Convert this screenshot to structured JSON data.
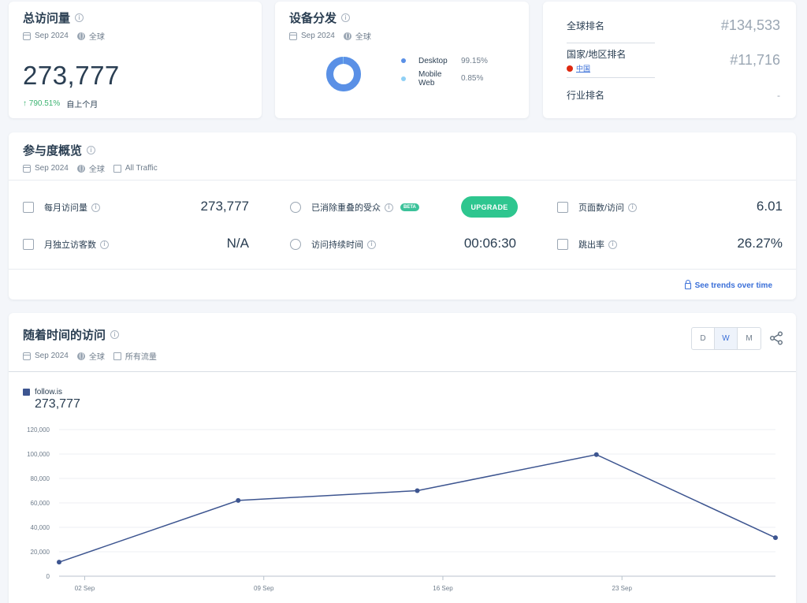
{
  "visits_card": {
    "title": "总访问量",
    "date": "Sep 2024",
    "region": "全球",
    "total": "273,777",
    "change": "↑ 790.51%",
    "change_label": "自上个月"
  },
  "device_card": {
    "title": "设备分发",
    "date": "Sep 2024",
    "region": "全球",
    "items": [
      {
        "name": "Desktop",
        "value": "99.15%",
        "share": 99.15,
        "color": "#5a90e6"
      },
      {
        "name": "Mobile Web",
        "value": "0.85%",
        "share": 0.85,
        "color": "#8fd0f5"
      }
    ]
  },
  "rank_card": {
    "global_label": "全球排名",
    "global_value": "#134,533",
    "country_label": "国家/地区排名",
    "country_name": "中国",
    "country_value": "#11,716",
    "industry_label": "行业排名",
    "industry_value": "-"
  },
  "engagement": {
    "title": "参与度概览",
    "date": "Sep 2024",
    "region": "全球",
    "traffic": "All Traffic",
    "monthly_label": "每月访问量",
    "monthly_value": "273,777",
    "unique_label": "月独立访客数",
    "unique_value": "N/A",
    "dedup_label": "已消除重叠的受众",
    "beta": "BETA",
    "upgrade": "UPGRADE",
    "duration_label": "访问持续时间",
    "duration_value": "00:06:30",
    "pages_label": "页面数/访问",
    "pages_value": "6.01",
    "bounce_label": "跳出率",
    "bounce_value": "26.27%",
    "trends_link": "See trends over time"
  },
  "time_card": {
    "title": "随着时间的访问",
    "date": "Sep 2024",
    "region": "全球",
    "traffic": "所有流量",
    "granularity": [
      "D",
      "W",
      "M"
    ],
    "selected": "W",
    "series_name": "follow.is",
    "series_total": "273,777"
  },
  "chart_data": {
    "type": "line",
    "x": [
      "2024-09-01",
      "2024-09-08",
      "2024-09-15",
      "2024-09-22",
      "2024-09-29"
    ],
    "x_tick_labels": [
      "02 Sep",
      "09 Sep",
      "16 Sep",
      "23 Sep"
    ],
    "y_tick_labels": [
      "120,000",
      "100,000",
      "80,000",
      "60,000",
      "40,000",
      "20,000",
      "0"
    ],
    "series": [
      {
        "name": "follow.is",
        "values": [
          11500,
          62000,
          70000,
          99500,
          31500
        ],
        "color": "#3d5590"
      }
    ],
    "ylim": [
      0,
      120000
    ],
    "grid": true
  }
}
